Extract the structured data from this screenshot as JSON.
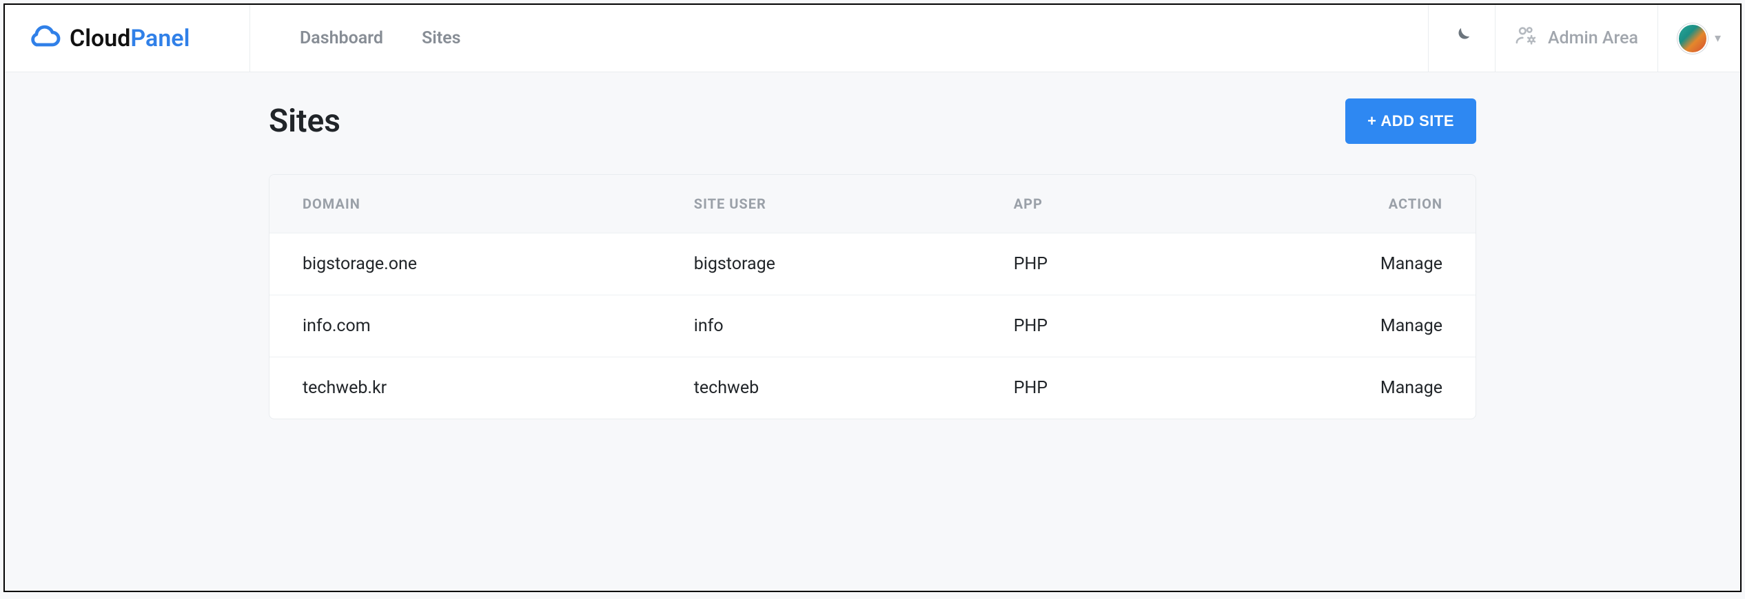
{
  "brand": {
    "cloud": "Cloud",
    "panel": "Panel"
  },
  "nav": {
    "items": [
      {
        "label": "Dashboard"
      },
      {
        "label": "Sites"
      }
    ]
  },
  "topbarRight": {
    "admin_label": "Admin Area"
  },
  "page": {
    "title": "Sites",
    "add_site_label": "+ ADD SITE"
  },
  "table": {
    "columns": {
      "domain": "DOMAIN",
      "site_user": "SITE USER",
      "app": "APP",
      "action": "ACTION"
    },
    "action_label": "Manage",
    "rows": [
      {
        "domain": "bigstorage.one",
        "site_user": "bigstorage",
        "app": "PHP"
      },
      {
        "domain": "info.com",
        "site_user": "info",
        "app": "PHP"
      },
      {
        "domain": "techweb.kr",
        "site_user": "techweb",
        "app": "PHP"
      }
    ]
  }
}
